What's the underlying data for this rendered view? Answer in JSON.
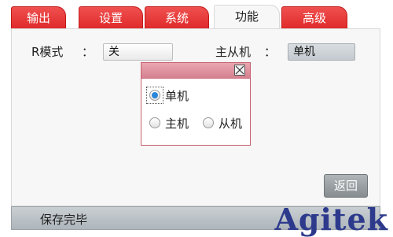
{
  "tabs": [
    {
      "label": "输出",
      "active": false
    },
    {
      "label": "设置",
      "active": false
    },
    {
      "label": "系统",
      "active": false
    },
    {
      "label": "功能",
      "active": true
    },
    {
      "label": "高级",
      "active": false
    }
  ],
  "settings": {
    "r_mode_label": "R模式",
    "r_mode_colon": "：",
    "r_mode_value": "关",
    "master_slave_label": "主从机",
    "master_slave_colon": "：",
    "master_slave_value": "单机"
  },
  "popup": {
    "options": [
      {
        "label": "单机",
        "selected": true
      },
      {
        "label": "主机",
        "selected": false
      },
      {
        "label": "从机",
        "selected": false
      }
    ]
  },
  "back_button_label": "返回",
  "status_text": "保存完毕",
  "watermark": "Agitek",
  "colors": {
    "tab_red": "#e83a3a",
    "popup_header": "#dc8c99",
    "radio_selected": "#2a86d9",
    "watermark": "#2d3a8c"
  }
}
